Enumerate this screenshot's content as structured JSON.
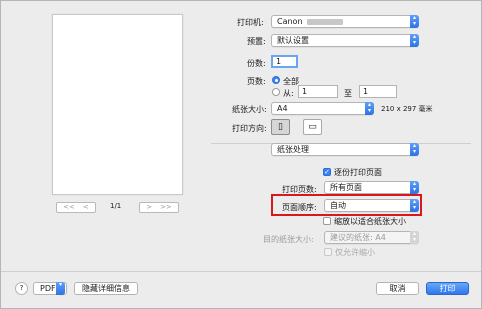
{
  "preview": {
    "page_count": "1/1",
    "first_label": "<<",
    "prev_label": "<",
    "next_label": ">",
    "last_label": ">>"
  },
  "printer": {
    "label": "打印机:",
    "value": "Canon"
  },
  "presets": {
    "label": "预置:",
    "value": "默认设置"
  },
  "copies": {
    "label": "份数:",
    "value": "1"
  },
  "pages": {
    "label": "页数:",
    "all_label": "全部",
    "from_label": "从:",
    "from_value": "1",
    "to_label": "至",
    "to_value": "1"
  },
  "paper_size": {
    "label": "纸张大小:",
    "value": "A4",
    "dimensions": "210 x 297 毫米"
  },
  "orientation": {
    "label": "打印方向:"
  },
  "panel_select": {
    "value": "纸张处理"
  },
  "collate": {
    "label": "逐份打印页面",
    "checked": true
  },
  "pages_to_print": {
    "label": "打印页数:",
    "value": "所有页面"
  },
  "page_order": {
    "label": "页面顺序:",
    "value": "自动"
  },
  "scale_to_fit": {
    "label": "缩放以适合纸张大小",
    "checked": false
  },
  "destination_paper": {
    "label": "目的纸张大小:",
    "value": "建议的纸张:  A4"
  },
  "scale_down_only": {
    "label": "仅允许缩小",
    "checked": false
  },
  "footer": {
    "help_label": "?",
    "pdf_label": "PDF",
    "hide_details_label": "隐藏详细信息",
    "cancel_label": "取消",
    "print_label": "打印"
  },
  "colors": {
    "accent": "#3b82f6",
    "highlight": "#d7191c"
  }
}
